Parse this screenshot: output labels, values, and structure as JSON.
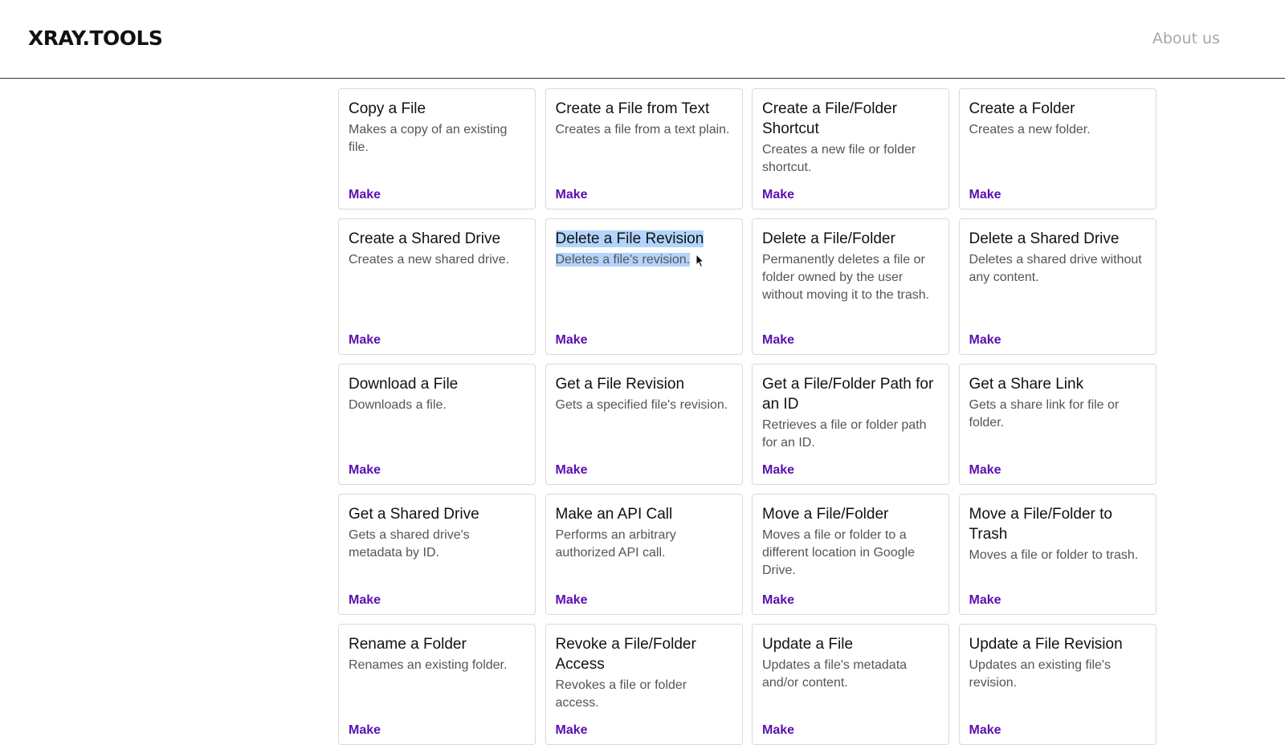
{
  "header": {
    "logo": "XRAY.TOOLS",
    "nav_about": "About us"
  },
  "colors": {
    "link": "#5b0fb0",
    "selection": "#b3d4fc",
    "about": "#a8a8a8"
  },
  "cards": [
    {
      "title": "Copy a File",
      "desc": "Makes a copy of an existing file.",
      "link": "Make"
    },
    {
      "title": "Create a File from Text",
      "desc": "Creates a file from a text plain.",
      "link": "Make"
    },
    {
      "title": "Create a File/Folder Shortcut",
      "desc": "Creates a new file or folder shortcut.",
      "link": "Make"
    },
    {
      "title": "Create a Folder",
      "desc": "Creates a new folder.",
      "link": "Make"
    },
    {
      "title": "Create a Shared Drive",
      "desc": "Creates a new shared drive.",
      "link": "Make"
    },
    {
      "title": "Delete a File Revision",
      "desc": "Deletes a file's revision.",
      "link": "Make",
      "selected": true
    },
    {
      "title": "Delete a File/Folder",
      "desc": "Permanently deletes a file or folder owned by the user without moving it to the trash.",
      "link": "Make"
    },
    {
      "title": "Delete a Shared Drive",
      "desc": "Deletes a shared drive without any content.",
      "link": "Make"
    },
    {
      "title": "Download a File",
      "desc": "Downloads a file.",
      "link": "Make"
    },
    {
      "title": "Get a File Revision",
      "desc": "Gets a specified file's revision.",
      "link": "Make"
    },
    {
      "title": "Get a File/Folder Path for an ID",
      "desc": "Retrieves a file or folder path for an ID.",
      "link": "Make"
    },
    {
      "title": "Get a Share Link",
      "desc": "Gets a share link for file or folder.",
      "link": "Make"
    },
    {
      "title": "Get a Shared Drive",
      "desc": "Gets a shared drive's metadata by ID.",
      "link": "Make"
    },
    {
      "title": "Make an API Call",
      "desc": "Performs an arbitrary authorized API call.",
      "link": "Make"
    },
    {
      "title": "Move a File/Folder",
      "desc": "Moves a file or folder to a different location in Google Drive.",
      "link": "Make"
    },
    {
      "title": "Move a File/Folder to Trash",
      "desc": "Moves a file or folder to trash.",
      "link": "Make"
    },
    {
      "title": "Rename a Folder",
      "desc": "Renames an existing folder.",
      "link": "Make"
    },
    {
      "title": "Revoke a File/Folder Access",
      "desc": "Revokes a file or folder access.",
      "link": "Make"
    },
    {
      "title": "Update a File",
      "desc": "Updates a file's metadata and/or content.",
      "link": "Make"
    },
    {
      "title": "Update a File Revision",
      "desc": "Updates an existing file's revision.",
      "link": "Make"
    }
  ]
}
